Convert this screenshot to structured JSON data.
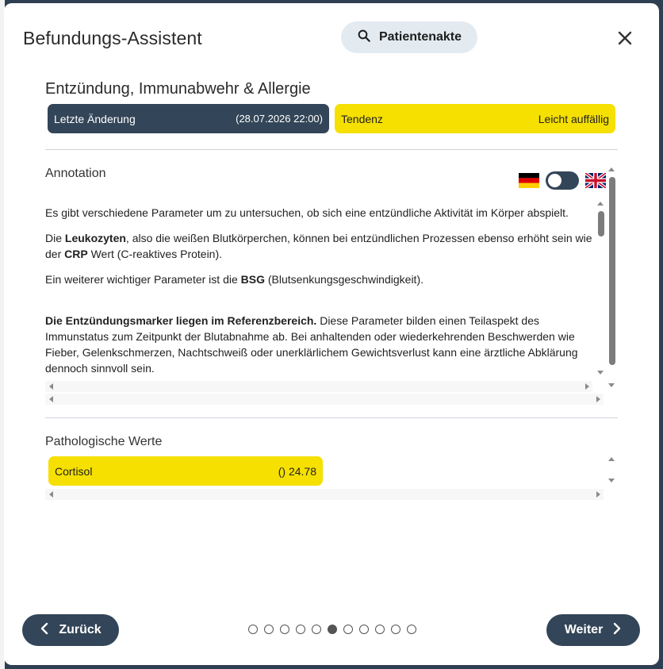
{
  "modal": {
    "title": "Befundungs-Assistent",
    "patient_button_label": "Patientenakte",
    "close_label": "✕"
  },
  "section": {
    "title": "Entzündung, Immunabwehr & Allergie",
    "last_change_label": "Letzte Änderung",
    "last_change_value": "(28.07.2026 22:00)",
    "trend_label": "Tendenz",
    "trend_value": "Leicht auffällig",
    "colors": {
      "dark": "#334558",
      "yellow": "#f5e000"
    }
  },
  "annotation": {
    "label": "Annotation",
    "language_toggle": {
      "left_flag": "german-flag-icon",
      "right_flag": "uk-flag-icon",
      "state": "de"
    },
    "p1": "Es gibt verschiedene Parameter um zu untersuchen, ob sich eine entzündliche Aktivität im Körper abspielt.",
    "p2_pre": "Die ",
    "p2_b1": "Leukozyten",
    "p2_mid": ", also die weißen Blutkörperchen, können bei entzündlichen Prozessen ebenso erhöht sein wie der ",
    "p2_b2": "CRP",
    "p2_post": " Wert (C-reaktives Protein).",
    "p3_pre": "Ein weiterer wichtiger Parameter ist die ",
    "p3_b": "BSG",
    "p3_post": " (Blutsenkungsgeschwindigkeit).",
    "p4_b": "Die Entzündungsmarker liegen im Referenzbereich.",
    "p4_post": " Diese Parameter bilden einen Teilaspekt des Immunstatus zum Zeitpunkt der Blutabnahme ab. Bei anhaltenden oder wiederkehrenden Beschwerden wie Fieber, Gelenkschmerzen, Nachtschweiß oder unerklärlichem Gewichtsverlust kann eine ärztliche Abklärung dennoch sinnvoll sein."
  },
  "pathological": {
    "label": "Pathologische Werte",
    "items": [
      {
        "name": "Cortisol",
        "value": "() 24.78"
      }
    ]
  },
  "navigation": {
    "back_label": "Zurück",
    "next_label": "Weiter",
    "total_steps": 11,
    "current_step": 6
  }
}
